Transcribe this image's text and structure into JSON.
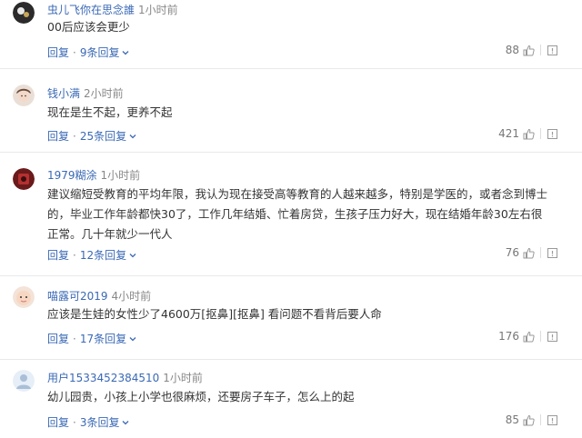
{
  "comments": [
    {
      "username": "虫儿飞你在思念誰",
      "time": "1小时前",
      "text": "00后应该会更少",
      "reply_label": "回复",
      "replies_label": "9条回复",
      "likes": "88",
      "avatar_icon": "avatar-dark-icon"
    },
    {
      "username": "钱小满",
      "time": "2小时前",
      "text": "现在是生不起，更养不起",
      "reply_label": "回复",
      "replies_label": "25条回复",
      "likes": "421",
      "avatar_icon": "avatar-girl-icon"
    },
    {
      "username": "1979糊涂",
      "time": "1小时前",
      "text": "建议缩短受教育的平均年限，我认为现在接受高等教育的人越来越多，特别是学医的，或者念到博士的，毕业工作年龄都快30了，工作几年结婚、忙着房贷，生孩子压力好大，现在结婚年龄30左右很正常。几十年就少一代人",
      "reply_label": "回复",
      "replies_label": "12条回复",
      "likes": "76",
      "avatar_icon": "avatar-red-icon"
    },
    {
      "username": "喵露可2019",
      "time": "4小时前",
      "text": "应该是生娃的女性少了4600万[抠鼻][抠鼻] 看问题不看背后要人命",
      "reply_label": "回复",
      "replies_label": "17条回复",
      "likes": "176",
      "avatar_icon": "avatar-baby-icon"
    },
    {
      "username": "用户1533452384510",
      "time": "1小时前",
      "text": "幼儿园贵，小孩上小学也很麻烦，还要房子车子，怎么上的起",
      "reply_label": "回复",
      "replies_label": "3条回复",
      "likes": "85",
      "avatar_icon": "avatar-default-icon"
    }
  ],
  "colors": {
    "username": "#3a69b5",
    "meta": "#888888",
    "text": "#333333"
  }
}
